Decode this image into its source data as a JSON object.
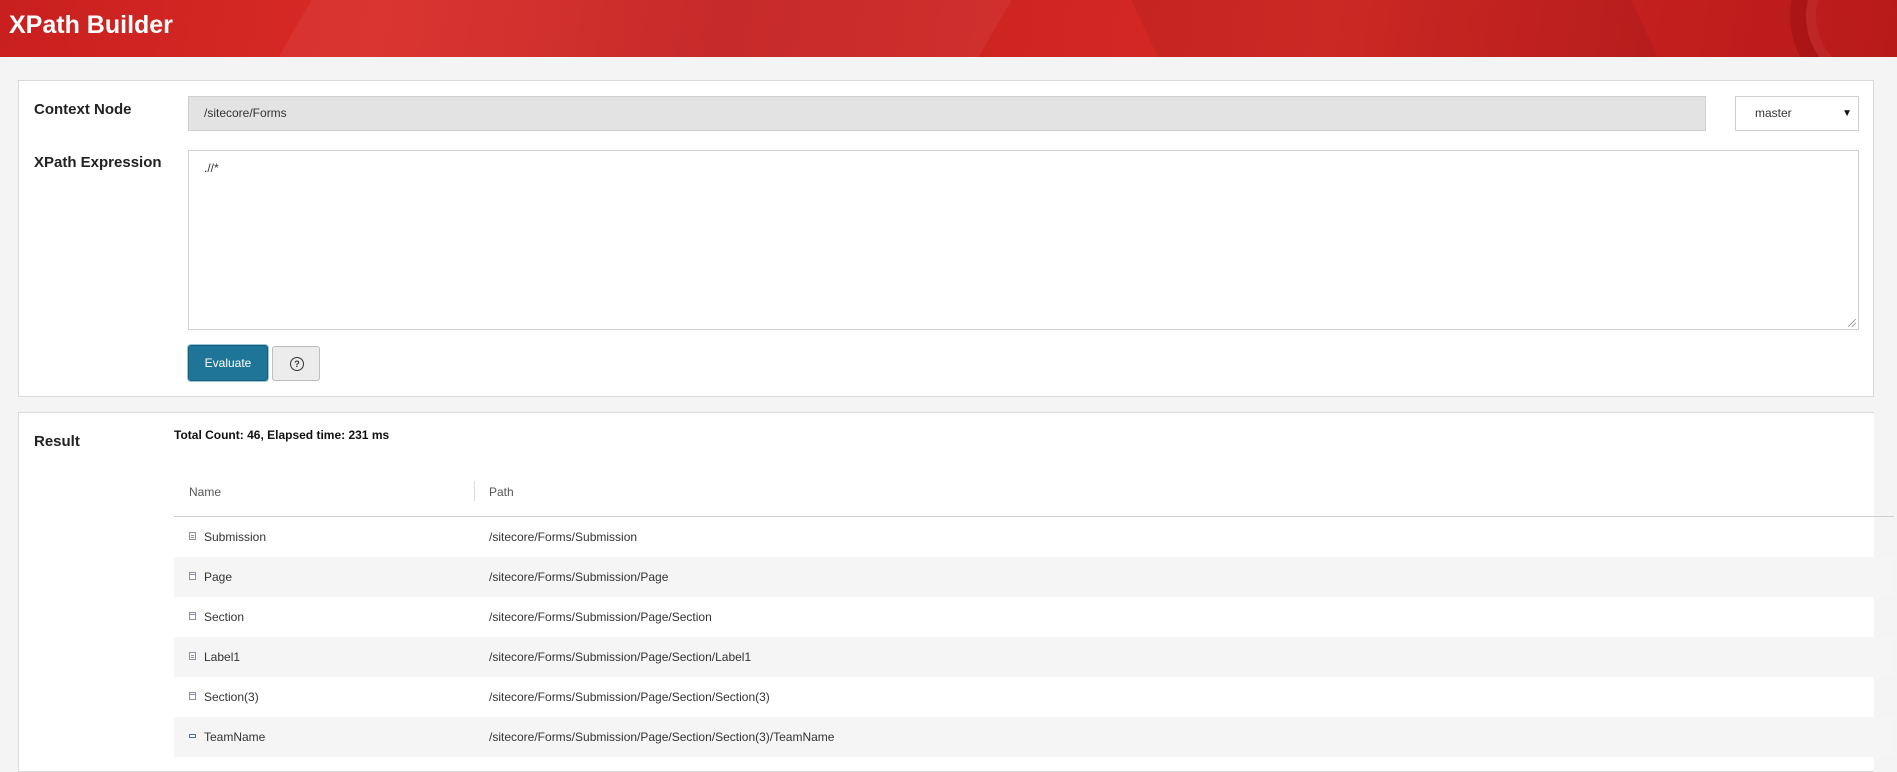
{
  "app": {
    "title": "XPath Builder"
  },
  "query": {
    "context_label": "Context Node",
    "context_value": "/sitecore/Forms",
    "database": "master",
    "expression_label": "XPath Expression",
    "expression_value": ".//*",
    "evaluate_label": "Evaluate",
    "help_glyph": "?"
  },
  "result": {
    "label": "Result",
    "summary": "Total Count: 46, Elapsed time: 231 ms",
    "columns": {
      "name": "Name",
      "path": "Path"
    },
    "rows": [
      {
        "icon": "form-icon",
        "name": "Submission",
        "path": "/sitecore/Forms/Submission"
      },
      {
        "icon": "page-icon",
        "name": "Page",
        "path": "/sitecore/Forms/Submission/Page"
      },
      {
        "icon": "section-icon",
        "name": "Section",
        "path": "/sitecore/Forms/Submission/Page/Section"
      },
      {
        "icon": "text-icon",
        "name": "Label1",
        "path": "/sitecore/Forms/Submission/Page/Section/Label1"
      },
      {
        "icon": "section-icon",
        "name": "Section(3)",
        "path": "/sitecore/Forms/Submission/Page/Section/Section(3)"
      },
      {
        "icon": "input-field-icon",
        "name": "TeamName",
        "path": "/sitecore/Forms/Submission/Page/Section/Section(3)/TeamName"
      }
    ]
  },
  "colors": {
    "header": "#c8201f",
    "evaluate_button": "#1e7598"
  }
}
